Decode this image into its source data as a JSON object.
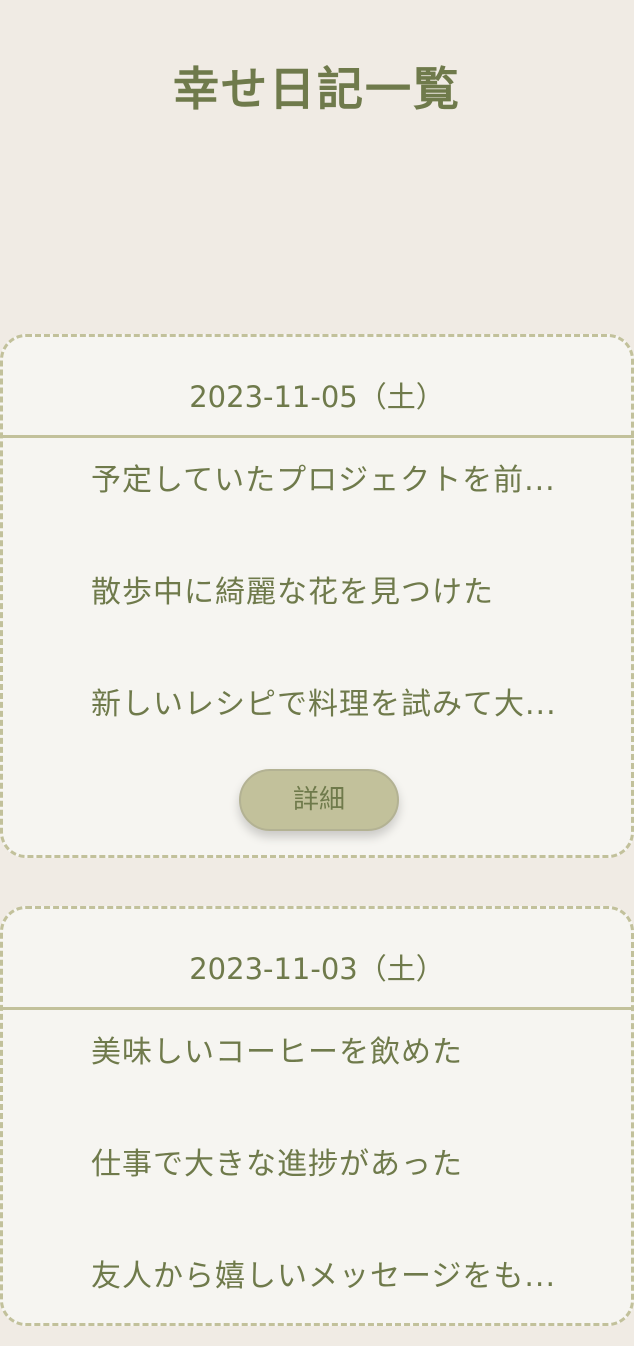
{
  "header": {
    "title": "幸せ日記一覧"
  },
  "entries": [
    {
      "date": "2023-11-05（土）",
      "items": [
        "予定していたプロジェクトを前...",
        "散歩中に綺麗な花を見つけた",
        "新しいレシピで料理を試みて大..."
      ],
      "detail_label": "詳細"
    },
    {
      "date": "2023-11-03（土）",
      "items": [
        "美味しいコーヒーを飲めた",
        "仕事で大きな進捗があった",
        "友人から嬉しいメッセージをも..."
      ]
    }
  ],
  "colors": {
    "background": "#f0ebe4",
    "card": "#f6f5f1",
    "accent": "#c2c19b",
    "text": "#6f7a4b"
  }
}
